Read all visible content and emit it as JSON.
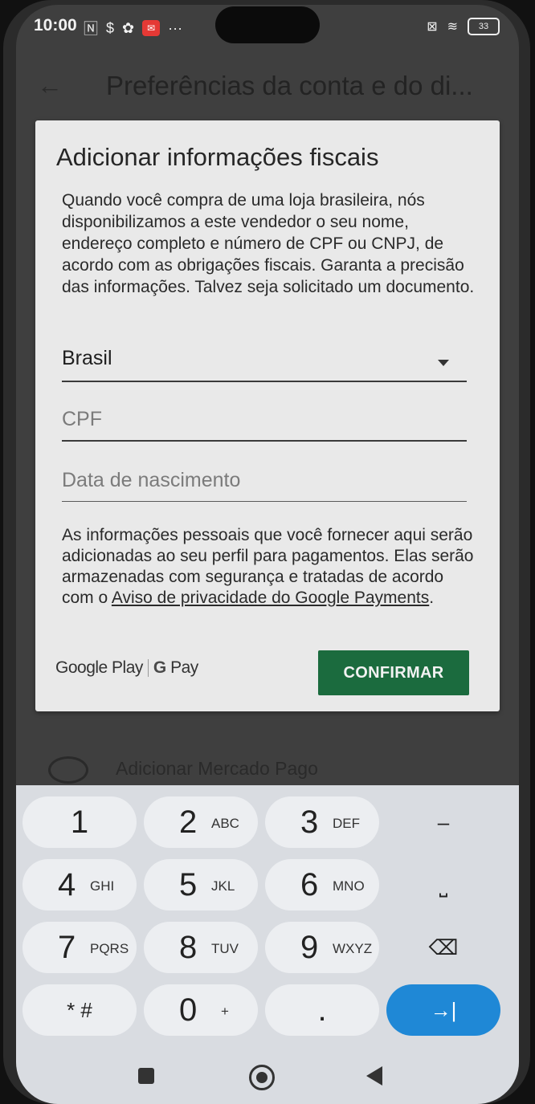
{
  "status_bar": {
    "time": "10:00",
    "battery": "33"
  },
  "app_bar": {
    "title": "Preferências da conta e do di..."
  },
  "dialog": {
    "title": "Adicionar informações fiscais",
    "body": "Quando você compra de uma loja brasileira, nós disponibilizamos a este vendedor o seu nome, endereço completo e número de CPF ou CNPJ, de acordo com as obrigações fiscais. Garanta a precisão das informações. Talvez seja solicitado um documento.",
    "country_value": "Brasil",
    "cpf_placeholder": "CPF",
    "dob_placeholder": "Data de nascimento",
    "note_text": "As informações pessoais que você fornecer aqui serão adicionadas ao seu perfil para pagamentos. Elas serão armazenadas com segurança e tratadas de acordo com o ",
    "note_link": "Aviso de privacidade do Google Payments",
    "note_end": ".",
    "brand_play": "Google Play",
    "brand_gpay_g": "G",
    "brand_gpay_text": "Pay",
    "confirm_label": "CONFIRMAR"
  },
  "background_row": {
    "label": "Adicionar Mercado Pago"
  },
  "keyboard": {
    "rows": [
      [
        {
          "num": "1",
          "sub": ""
        },
        {
          "num": "2",
          "sub": "ABC"
        },
        {
          "num": "3",
          "sub": "DEF"
        },
        {
          "num": "–",
          "sub": ""
        }
      ],
      [
        {
          "num": "4",
          "sub": "GHI"
        },
        {
          "num": "5",
          "sub": "JKL"
        },
        {
          "num": "6",
          "sub": "MNO"
        },
        {
          "num": "⎵",
          "sub": ""
        }
      ],
      [
        {
          "num": "7",
          "sub": "PQRS"
        },
        {
          "num": "8",
          "sub": "TUV"
        },
        {
          "num": "9",
          "sub": "WXYZ"
        },
        {
          "num": "⌫",
          "sub": ""
        }
      ],
      [
        {
          "num": "* #",
          "sub": ""
        },
        {
          "num": "0",
          "sub": "+"
        },
        {
          "num": ".",
          "sub": ""
        },
        {
          "num": "→|",
          "sub": ""
        }
      ]
    ]
  },
  "colors": {
    "confirm_bg": "#1b6b3e",
    "action_key": "#1f88d6"
  }
}
